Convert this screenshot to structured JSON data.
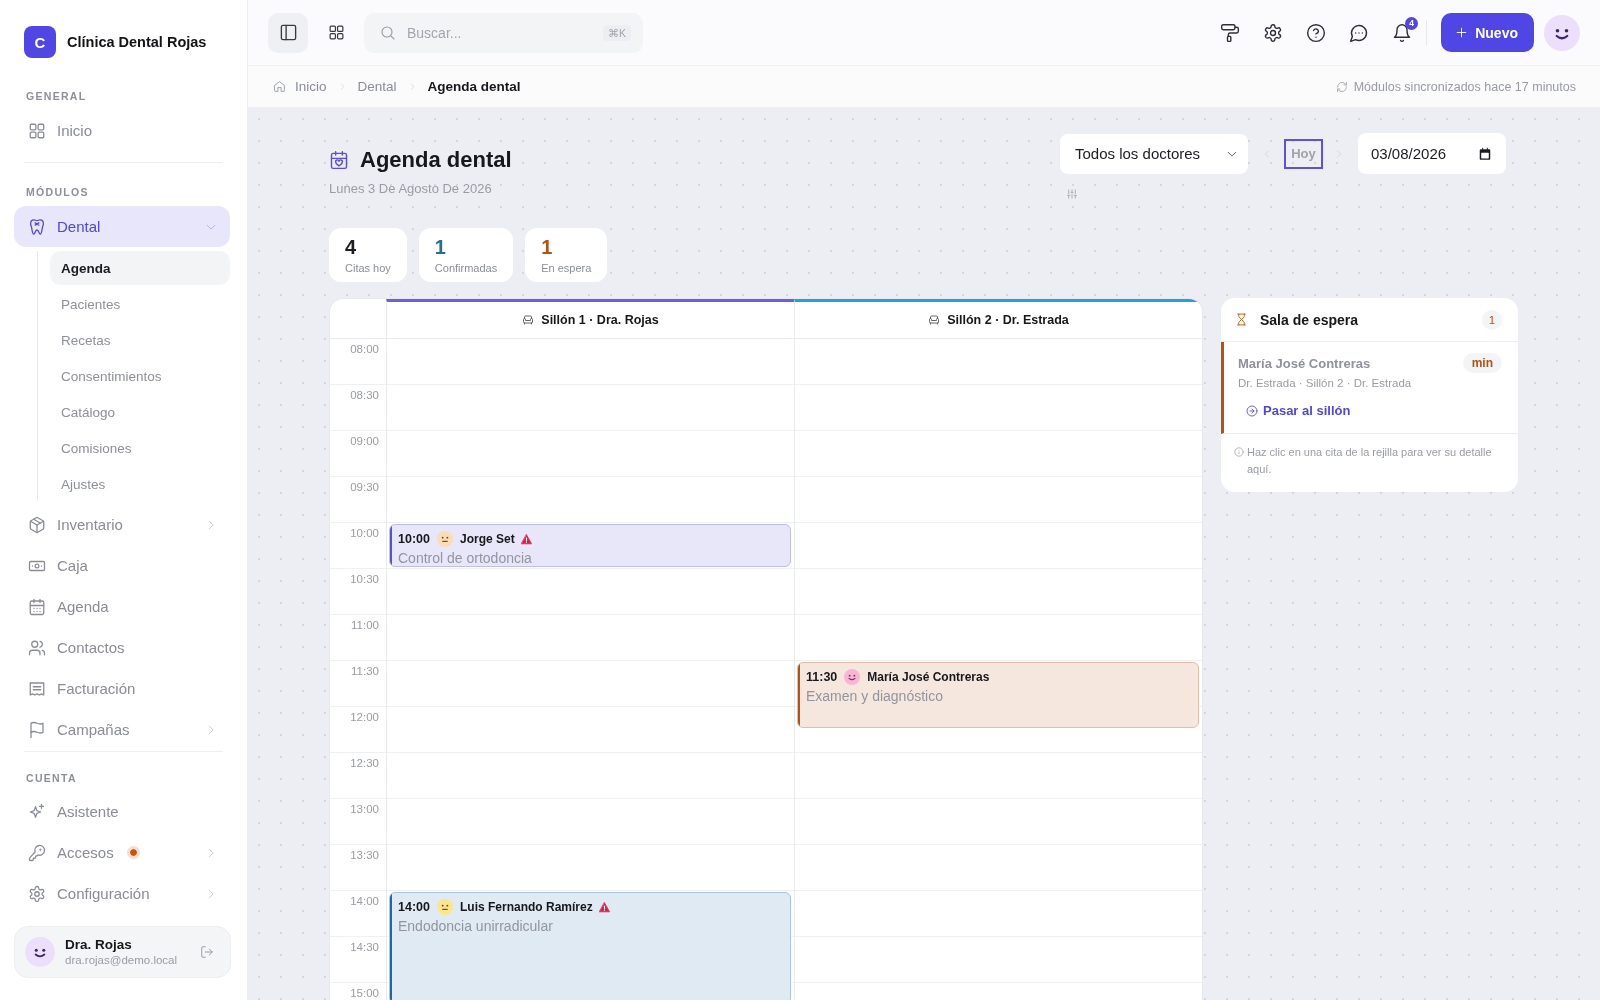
{
  "sidebar": {
    "brand": {
      "initial": "C",
      "name": "Clínica Dental Rojas"
    },
    "sections": [
      {
        "title": "GENERAL",
        "items": [
          {
            "label": "Inicio",
            "kind": "link",
            "selected": false
          }
        ]
      },
      {
        "title": "MÓDULOS",
        "items": [
          {
            "label": "Dental",
            "kind": "group",
            "selected": true,
            "expanded": true,
            "children": [
              {
                "label": "Agenda",
                "selected": true
              },
              {
                "label": "Pacientes",
                "selected": false
              },
              {
                "label": "Recetas",
                "selected": false
              },
              {
                "label": "Consentimientos",
                "selected": false
              },
              {
                "label": "Catálogo",
                "selected": false
              },
              {
                "label": "Comisiones",
                "selected": false
              },
              {
                "label": "Ajustes",
                "selected": false
              }
            ]
          },
          {
            "label": "Inventario",
            "kind": "group",
            "selected": false,
            "expanded": false
          },
          {
            "label": "Caja",
            "kind": "link",
            "selected": false
          },
          {
            "label": "Agenda",
            "kind": "link",
            "selected": false
          },
          {
            "label": "Contactos",
            "kind": "link",
            "selected": false
          },
          {
            "label": "Facturación",
            "kind": "link",
            "selected": false
          },
          {
            "label": "Campañas",
            "kind": "group",
            "selected": false,
            "expanded": false
          }
        ]
      },
      {
        "title": "CUENTA",
        "items": [
          {
            "label": "Asistente",
            "kind": "link",
            "selected": false
          },
          {
            "label": "Accesos",
            "kind": "group",
            "selected": false,
            "expanded": false,
            "attention": true
          },
          {
            "label": "Configuración",
            "kind": "group",
            "selected": false,
            "expanded": false
          }
        ]
      }
    ],
    "user": {
      "name": "Dra. Rojas",
      "email": "dra.rojas@demo.local"
    }
  },
  "topbar": {
    "search": {
      "placeholder": "Buscar...",
      "shortcut": "⌘K"
    },
    "notifications": {
      "count": "4"
    },
    "new_button": "Nuevo"
  },
  "breadcrumb": {
    "items": [
      "Inicio",
      "Dental",
      "Agenda dental"
    ],
    "sync_status": "Módulos sincronizados hace 17 minutos"
  },
  "page": {
    "title": "Agenda dental",
    "subtitle": "Lunes 3 De Agosto De 2026",
    "doctor_filter": {
      "value": "Todos los doctores"
    },
    "today_button": {
      "label": "Hoy",
      "focused": true
    },
    "date_field": {
      "value": "03/08/2026"
    }
  },
  "stats": [
    {
      "value": "4",
      "label": "Citas hoy",
      "color": "#1c1c22"
    },
    {
      "value": "1",
      "label": "Confirmadas",
      "color": "#1f6f9f"
    },
    {
      "value": "1",
      "label": "En espera",
      "color": "#b4530f"
    }
  ],
  "calendar": {
    "times": [
      "08:00",
      "08:30",
      "09:00",
      "09:30",
      "10:00",
      "10:30",
      "11:00",
      "11:30",
      "12:00",
      "12:30",
      "13:00",
      "13:30",
      "14:00",
      "14:30",
      "15:00"
    ],
    "chairs": [
      {
        "label": "Sillón 1 · Dra. Rojas",
        "color": "#6c5ce7",
        "appointments": [
          {
            "kind": "short",
            "time": "10:00",
            "patient": "Jorge Set",
            "treatment": "Control de ortodoncia",
            "color": "#5b4fd6",
            "face": {
              "kind": "neutral",
              "color": "#fcdcb4"
            },
            "alert": true
          },
          {
            "kind": "long",
            "time": "14:00",
            "patient": "Luis Fernando Ramírez",
            "treatment": "Endodoncia unirradicular",
            "color": "#1d6aa0",
            "face": {
              "kind": "neutral",
              "color": "#fde68a"
            },
            "alert": true
          }
        ]
      },
      {
        "label": "Sillón 2 · Dr. Estrada",
        "color": "#1aa3e0",
        "appointments": [
          {
            "kind": "medium",
            "time": "11:30",
            "patient": "María José Contreras",
            "treatment": "Examen y diagnóstico",
            "color": "#b4530f",
            "face": {
              "kind": "happy",
              "color": "#f9b4d6"
            },
            "alert": false
          }
        ]
      }
    ]
  },
  "waiting_room": {
    "title": "Sala de espera",
    "count": "1",
    "patients": [
      {
        "name": "María José Contreras",
        "wait": "min",
        "details": "Dr. Estrada · Sillón 2 · Dr. Estrada",
        "action": "Pasar al sillón"
      }
    ],
    "hint": "Haz clic en una cita de la rejilla para ver su detalle aquí."
  }
}
